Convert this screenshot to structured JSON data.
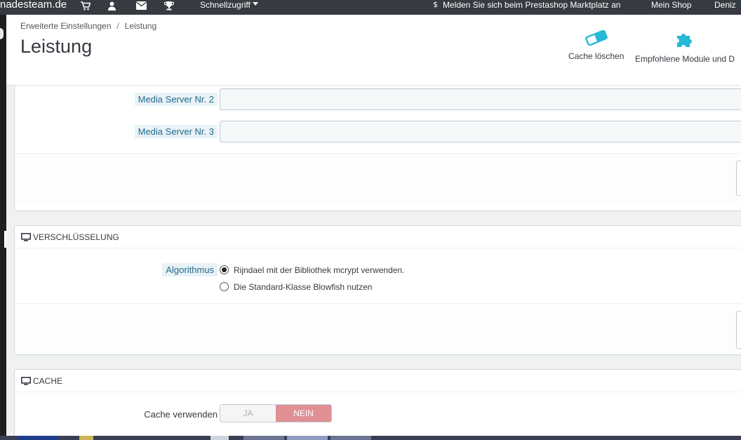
{
  "topbar": {
    "brand": "nadesteam.de",
    "quick_access": "Schnellzugriff",
    "marketplace": "Melden Sie sich beim Prestashop Marktplatz an",
    "my_shop": "Mein Shop",
    "user": "Deniz"
  },
  "header": {
    "breadcrumb": [
      "Erweiterte Einstellungen",
      "Leistung"
    ],
    "title": "Leistung",
    "toolbar": {
      "clear_cache": "Cache löschen",
      "recommended_modules": "Empfohlene Module und D"
    }
  },
  "media_servers": {
    "fields": [
      {
        "label": "Media Server Nr. 2",
        "value": ""
      },
      {
        "label": "Media Server Nr. 3",
        "value": ""
      }
    ]
  },
  "encryption": {
    "heading": "VERSCHLÜSSELUNG",
    "label": "Algorithmus",
    "options": [
      {
        "label": "Rijndael mit der Bibliothek mcrypt verwenden.",
        "selected": true
      },
      {
        "label": "Die Standard-Klasse Blowfish nutzen",
        "selected": false
      }
    ]
  },
  "cache": {
    "heading": "CACHE",
    "use_cache_label": "Cache verwenden",
    "yes": "JA",
    "no": "NEIN",
    "selected": "NEIN"
  },
  "colors": {
    "topbar": "#363a41",
    "accent": "#25b9d7",
    "label_bg": "#e8f2f7",
    "switch_no": "#e08f95"
  }
}
